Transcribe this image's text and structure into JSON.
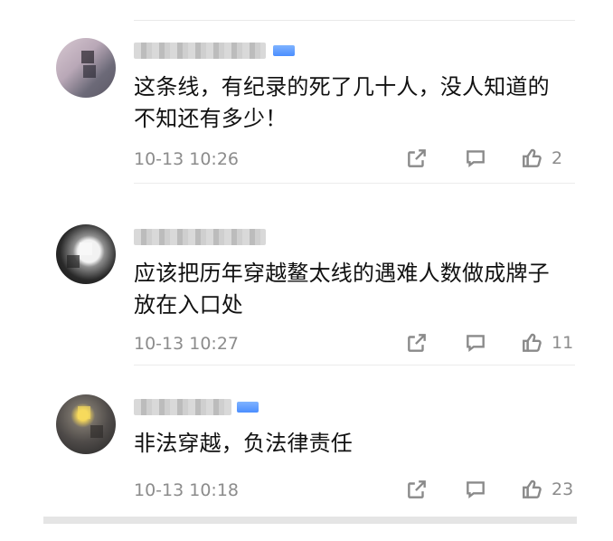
{
  "comments": [
    {
      "text": "这条线，有纪录的死了几十人，没人知道的\n不知还有多少！",
      "time": "10-13 10:26",
      "likes": "2",
      "verified_badge": false
    },
    {
      "text": "应该把历年穿越鳌太线的遇难人数做成牌子\n放在入口处",
      "time": "10-13 10:27",
      "likes": "11",
      "verified_badge": false
    },
    {
      "text": "非法穿越，负法律责任",
      "time": "10-13 10:18",
      "likes": "23",
      "verified_badge": true
    }
  ],
  "icons": {
    "share": "share-icon",
    "reply": "comment-icon",
    "like": "thumbs-up-icon",
    "badge": "verified-badge-icon"
  },
  "colors": {
    "text": "#111111",
    "muted": "#8c8c8c",
    "divider": "#ececec",
    "badge": "#f5a623",
    "vip": "#4b8eff"
  }
}
